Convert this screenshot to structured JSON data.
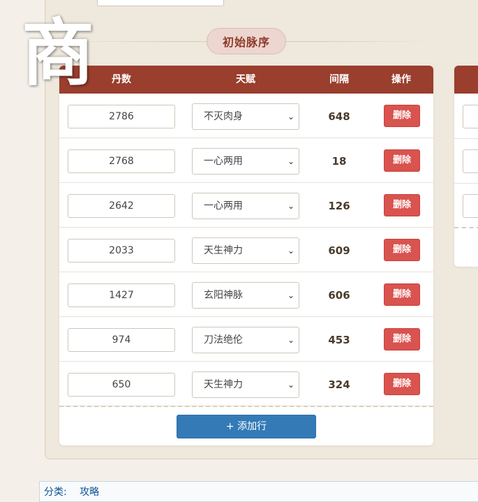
{
  "watermark_char": "商",
  "section": {
    "title": "初始脉序"
  },
  "table": {
    "headers": {
      "count": "丹数",
      "talent": "天赋",
      "gap": "间隔",
      "action": "操作"
    },
    "rows": [
      {
        "count": "2786",
        "talent": "不灭肉身",
        "gap": "648"
      },
      {
        "count": "2768",
        "talent": "一心两用",
        "gap": "18"
      },
      {
        "count": "2642",
        "talent": "一心两用",
        "gap": "126"
      },
      {
        "count": "2033",
        "talent": "天生神力",
        "gap": "609"
      },
      {
        "count": "1427",
        "talent": "玄阳神脉",
        "gap": "606"
      },
      {
        "count": "974",
        "talent": "刀法绝伦",
        "gap": "453"
      },
      {
        "count": "650",
        "talent": "天生神力",
        "gap": "324"
      }
    ],
    "delete_label": "删除",
    "add_row_label": "+ 添加行",
    "select_chevron": "⌄"
  },
  "footer": {
    "category_label": "分类:",
    "category_link": "攻略"
  }
}
